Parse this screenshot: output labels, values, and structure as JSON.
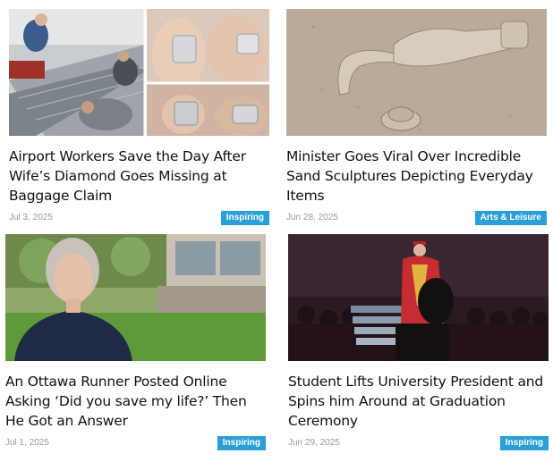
{
  "articles": [
    {
      "title": "Airport Workers Save the Day After Wife’s Diamond Goes Missing at Baggage Claim",
      "date": "Jul 3, 2025",
      "category": "Inspiring"
    },
    {
      "title": "Minister Goes Viral Over Incredible Sand Sculptures Depicting Everyday Items",
      "date": "Jun 28, 2025",
      "category": "Arts & Leisure"
    },
    {
      "title": "An Ottawa Runner Posted Online Asking ‘Did you save my life?’ Then He Got an Answer",
      "date": "Jul 1, 2025",
      "category": "Inspiring"
    },
    {
      "title": "Student Lifts University President and Spins him Around at Graduation Ceremony",
      "date": "Jun 29, 2025",
      "category": "Inspiring"
    }
  ],
  "colors": {
    "badge": "#2a9fd8",
    "date": "#9a9a9a",
    "title": "#111111"
  }
}
